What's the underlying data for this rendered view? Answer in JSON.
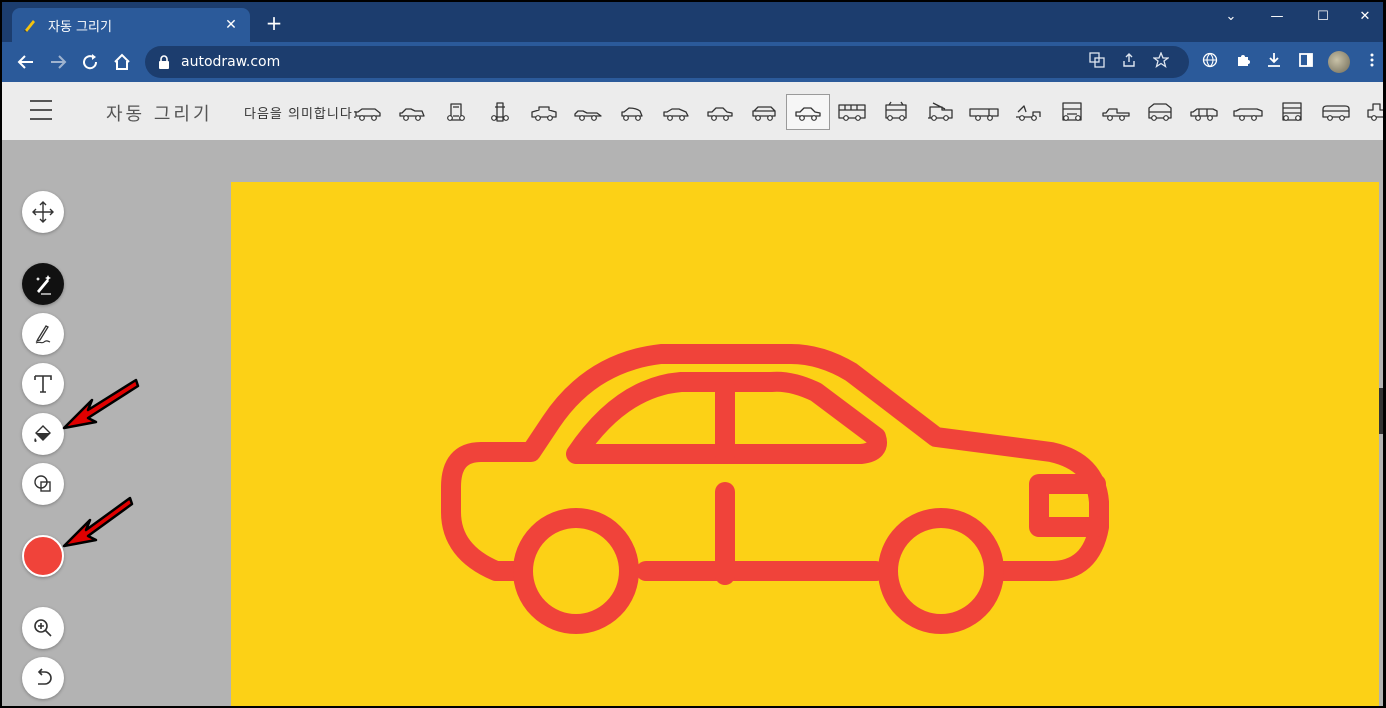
{
  "browser": {
    "tab_title": "자동 그리기",
    "new_tab": "+",
    "tab_close": "✕",
    "url": "autodraw.com",
    "window_controls": [
      "⌄",
      "—",
      "☐",
      "✕"
    ]
  },
  "app": {
    "title": "자동 그리기",
    "suggest_label": "다음을 의미합니다:",
    "suggestion_icons": [
      "sports-car",
      "compact-car",
      "car-top-view",
      "car-top-view-2",
      "convertible",
      "race-car",
      "small-car",
      "coupe",
      "sedan",
      "suv",
      "selected-sedan",
      "bus",
      "trolley",
      "fire-truck",
      "semi-trailer",
      "tow-truck",
      "truck-front",
      "pickup",
      "jeep",
      "station-wagon",
      "limo",
      "double-decker",
      "minibus",
      "tractor"
    ],
    "selected_index": 10
  },
  "tools": [
    "move-tool",
    "autodraw-tool",
    "draw-tool",
    "text-tool",
    "fill-tool",
    "shape-tool",
    "color-picker",
    "zoom-tool",
    "undo-tool"
  ],
  "colors": {
    "canvas_bg": "#fcd116",
    "drawing": "#f0433a",
    "arrow": "#e00000"
  }
}
